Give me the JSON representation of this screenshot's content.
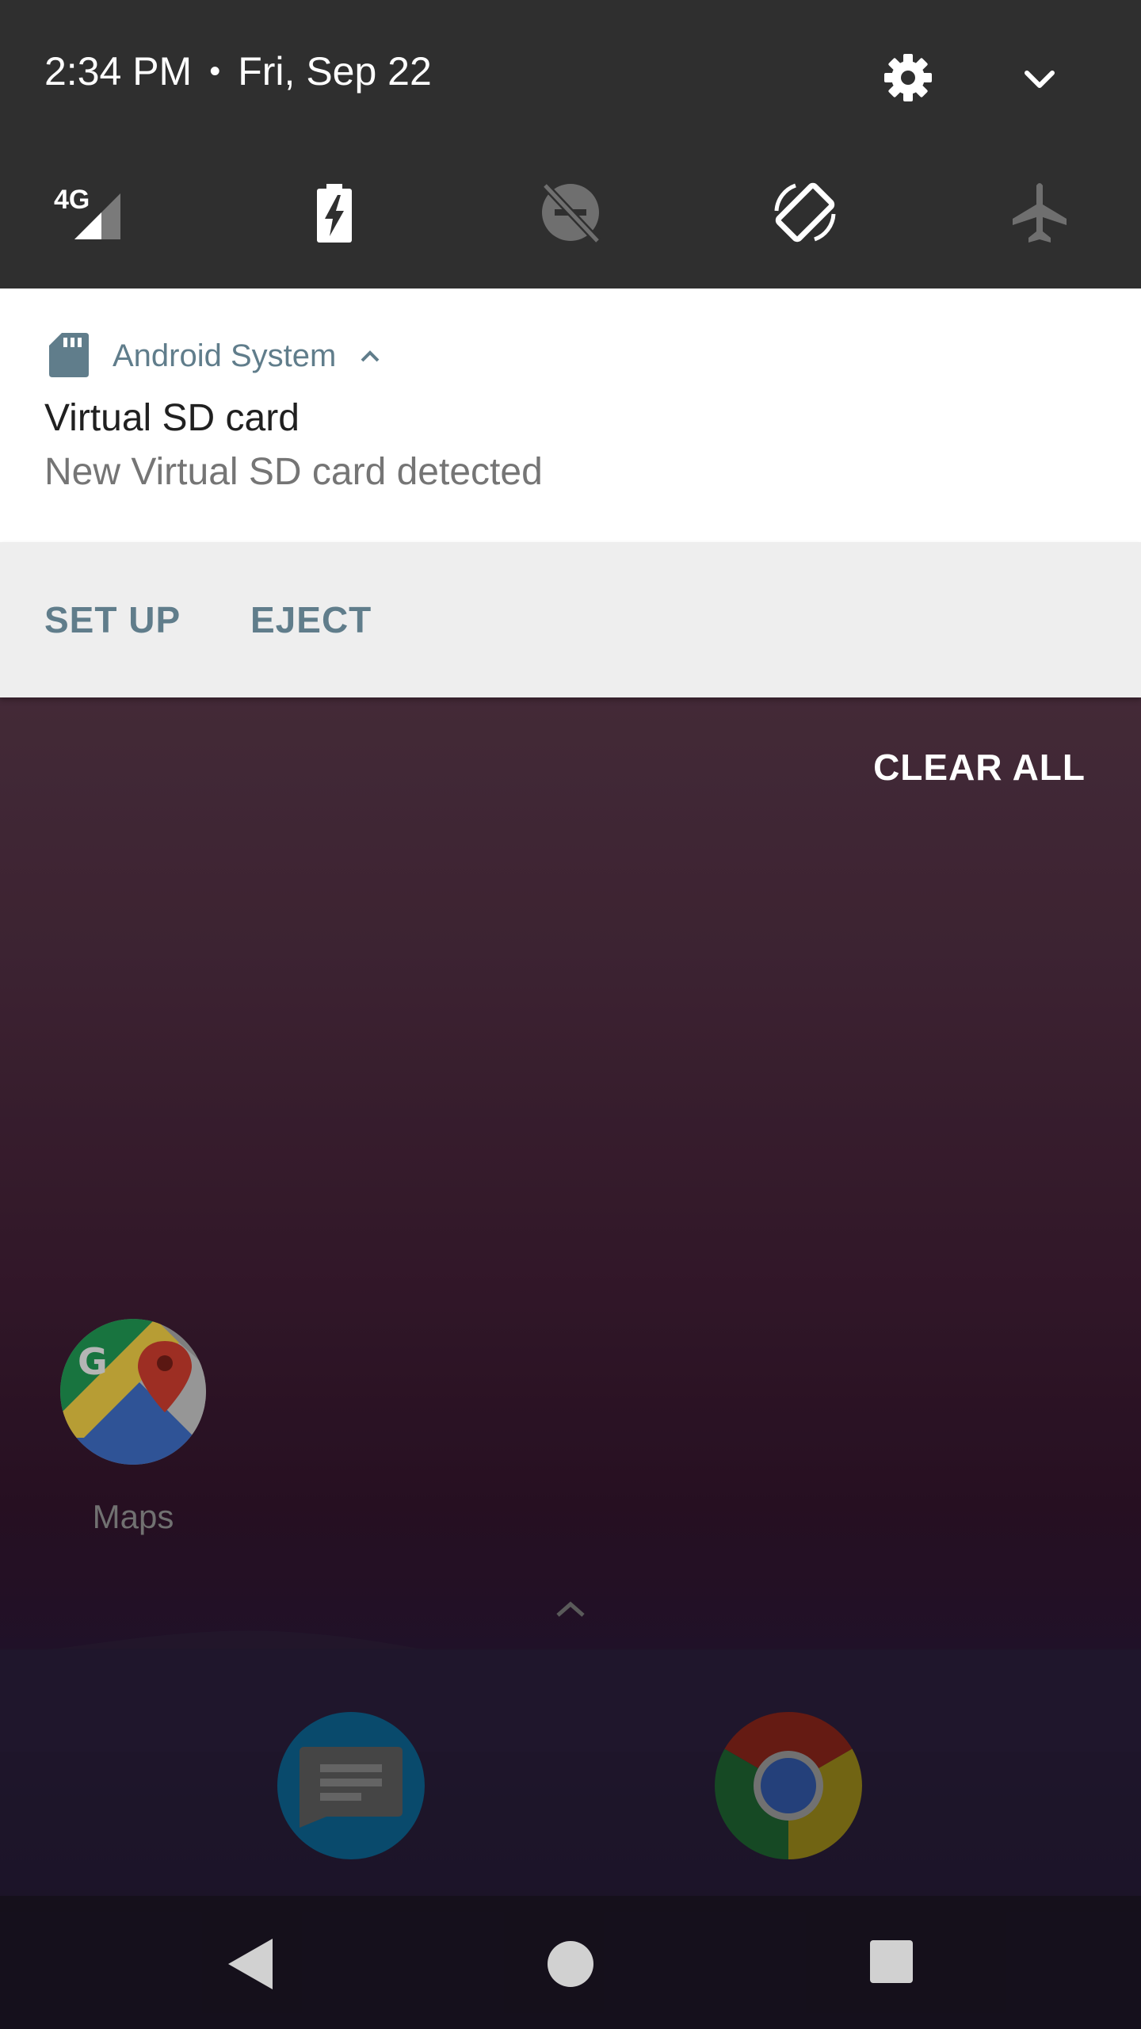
{
  "quick_settings": {
    "time": "2:34 PM",
    "separator": "•",
    "date": "Fri, Sep 22",
    "settings_icon": "gear-icon",
    "expand_icon": "chevron-down-icon",
    "tiles": [
      {
        "icon": "cellular-4g-icon",
        "label": "4G"
      },
      {
        "icon": "battery-saver-icon"
      },
      {
        "icon": "do-not-disturb-off-icon"
      },
      {
        "icon": "auto-rotate-icon"
      },
      {
        "icon": "airplane-mode-icon"
      }
    ],
    "colors": {
      "background": "#2f2f2f",
      "active_icon": "#ffffff",
      "inactive_icon": "#6f6f6f"
    }
  },
  "notification": {
    "app_icon": "sd-card-icon",
    "app_name": "Android System",
    "collapse_icon": "chevron-up-icon",
    "title": "Virtual SD card",
    "text": "New Virtual SD card detected",
    "actions": [
      {
        "label": "SET UP"
      },
      {
        "label": "EJECT"
      }
    ],
    "colors": {
      "accent": "#607d8b",
      "actions_background": "#eeeeee"
    }
  },
  "clear_all_label": "CLEAR ALL",
  "home_screen": {
    "apps": [
      {
        "icon": "maps-app-icon",
        "label": "Maps"
      }
    ],
    "drawer_handle_icon": "chevron-up-icon",
    "dock": [
      {
        "icon": "messages-app-icon"
      },
      {
        "icon": "chrome-app-icon"
      }
    ]
  },
  "navigation_bar": {
    "back_icon": "back-triangle-icon",
    "home_icon": "home-circle-icon",
    "recents_icon": "recents-square-icon"
  }
}
